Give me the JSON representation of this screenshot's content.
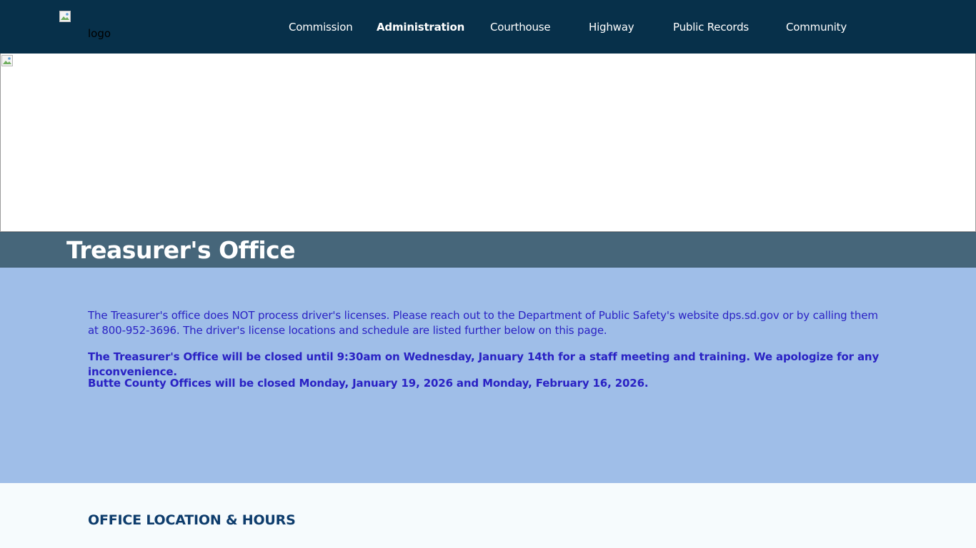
{
  "header": {
    "logo_alt": "logo",
    "nav": [
      {
        "label": "Commission"
      },
      {
        "label": "Administration",
        "active": true
      },
      {
        "label": "Courthouse"
      },
      {
        "label": "Highway"
      },
      {
        "label": "Public Records"
      },
      {
        "label": "Community"
      }
    ]
  },
  "page": {
    "title": "Treasurer's Office"
  },
  "notice": {
    "paragraphs": [
      "The Treasurer's office does NOT process driver's licenses. Please reach out to the Department of Public Safety's website dps.sd.gov or by calling them at 800-952-3696. The driver's license locations and schedule are listed further below on this page.",
      "The Treasurer's Office will be closed until 9:30am on Wednesday, January 14th for a staff meeting and training. We apologize for any inconvenience.",
      "Butte County Offices will be closed Monday, January 19, 2026 and Monday, February 16, 2026."
    ]
  },
  "office": {
    "heading": "OFFICE LOCATION & HOURS"
  },
  "colors": {
    "navbar": "#07304a",
    "title_band": "#46667a",
    "notice_bg": "#9fbee8",
    "notice_text": "#2a22c4",
    "heading": "#0d3c6c"
  }
}
